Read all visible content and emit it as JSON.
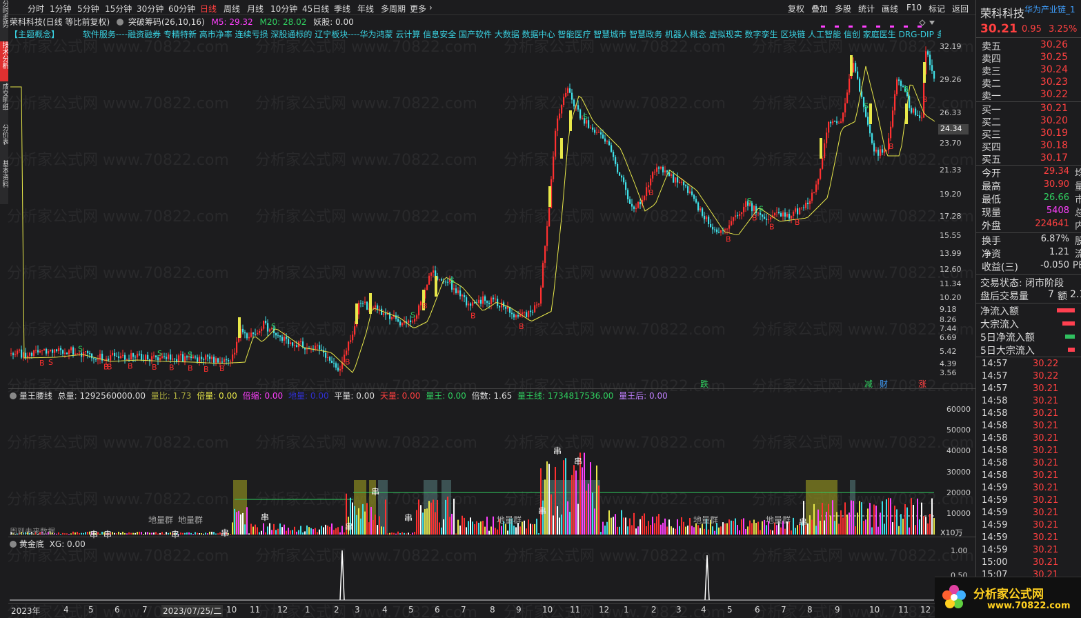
{
  "topbar": {
    "items": [
      "分时",
      "1分钟",
      "5分钟",
      "15分钟",
      "30分钟",
      "60分钟",
      "日线",
      "周线",
      "月线",
      "10分钟",
      "45日线",
      "季线",
      "年线",
      "多周期",
      "更多"
    ],
    "active": "日线",
    "right": [
      "复权",
      "叠加",
      "多股",
      "统计",
      "画线",
      "F10",
      "标记",
      "返回"
    ]
  },
  "lefttabs": [
    "分时走势",
    "技术分析",
    "成交明细",
    "分价表",
    "基本资料"
  ],
  "title": {
    "stock": "荣科科技(日线 等比前复权)",
    "indicator": "突破筹码(26,10,16)",
    "m5": "M5: 29.32",
    "m20": "M20: 28.02",
    "yao": "妖股: 0.00"
  },
  "concepts": {
    "label": "【主题概念】",
    "text": "软件服务----融资融券 专精特新 高市净率 连续亏损 深股通标的 辽宁板块----华为鸿蒙 云计算 信息安全 国产软件 大数据 数据中心 智能医疗 智慧城市 智慧政务 机器人概念 虚拟现实 数字孪生 区块链 人工智能 信创 家庭医生 DRG-DIP 多"
  },
  "price_axis": [
    "32.19",
    "29.26",
    "26.33",
    "23.70",
    "21.33",
    "19.20",
    "17.28",
    "15.55",
    "13.99",
    "12.60",
    "11.34",
    "10.20",
    "9.18",
    "8.26",
    "7.44",
    "6.69",
    "5.42",
    "4.39",
    "3.56"
  ],
  "current_price_tag": "24.34",
  "chart_markers": {
    "die": "跌",
    "jian": "减",
    "cai": "财",
    "zhang": "涨"
  },
  "ind1": {
    "name": "量王腰线",
    "zongliang": "总量: 1292560000.00",
    "liangbi": "量比: 1.73",
    "beiliang": "倍量: 0.00",
    "beisuo": "倍缩: 0.00",
    "hidden": "地量: 0.00",
    "pingliang": "平量: 0.00",
    "tianliang": "天量: 0.00",
    "liangwang": "量王: 0.00",
    "beishu": "倍数: 1.65",
    "liangwangxian": "量王线: 1734817536.00",
    "liangwanghou": "量王后: 0.00"
  },
  "vol_axis": [
    "60000",
    "50000",
    "40000",
    "30000",
    "20000",
    "10000"
  ],
  "vol_unit": "X10万",
  "vol_labels": [
    "地量群",
    "地量群",
    "地量群",
    "地量群",
    "地量群"
  ],
  "vol_marks": [
    "串",
    "串",
    "串",
    "串",
    "串",
    "串",
    "串",
    "串",
    "串"
  ],
  "vol_bottom_text": "周到未来数据",
  "ind2": {
    "name": "黄金底",
    "xg": "XG: 0.00"
  },
  "ind2_axis": [
    "1.00",
    "0.50"
  ],
  "xaxis": {
    "year": "2023年",
    "date": "2023/07/25/二",
    "months": [
      "4",
      "5",
      "6",
      "7",
      "10",
      "11",
      "12",
      "1",
      "2",
      "3",
      "4",
      "5",
      "6",
      "7",
      "8",
      "9",
      "10",
      "11",
      "12",
      "1",
      "2",
      "3",
      "4",
      "5",
      "6",
      "7",
      "8",
      "9",
      "10",
      "11",
      "12"
    ]
  },
  "quote": {
    "name": "荣科科技",
    "tag": "华为产业链_1",
    "price": "30.21",
    "change": "0.95",
    "pct": "3.25%"
  },
  "asks": [
    {
      "k": "卖五",
      "v": "30.26"
    },
    {
      "k": "卖四",
      "v": "30.25"
    },
    {
      "k": "卖三",
      "v": "30.24"
    },
    {
      "k": "卖二",
      "v": "30.23"
    },
    {
      "k": "卖一",
      "v": "30.22"
    }
  ],
  "bids": [
    {
      "k": "买一",
      "v": "30.21"
    },
    {
      "k": "买二",
      "v": "30.20"
    },
    {
      "k": "买三",
      "v": "30.19"
    },
    {
      "k": "买四",
      "v": "30.18"
    },
    {
      "k": "买五",
      "v": "30.17"
    }
  ],
  "stats": [
    {
      "k": "今开",
      "v": "29.34",
      "e": "均"
    },
    {
      "k": "最高",
      "v": "30.90",
      "e": "量"
    },
    {
      "k": "最低",
      "v": "26.66",
      "e": "市"
    },
    {
      "k": "现量",
      "v": "5408",
      "e": "总"
    },
    {
      "k": "外盘",
      "v": "224641",
      "e": "内"
    }
  ],
  "stats2": [
    {
      "k": "换手",
      "v": "6.87%",
      "e": "股"
    },
    {
      "k": "净资",
      "v": "1.21",
      "e": "流"
    },
    {
      "k": "收益(三)",
      "v": "-0.050",
      "e": "PE"
    }
  ],
  "trade": {
    "state": "交易状态: 闭市阶段",
    "after": "盘后交易量",
    "after_v": "7",
    "after_e": "额",
    "after_e2": "2.1"
  },
  "flows": [
    "净流入额",
    "大宗流入",
    "5日净流入额",
    "5日大宗流入"
  ],
  "ticks": [
    {
      "t": "14:57",
      "p": "30.22"
    },
    {
      "t": "14:57",
      "p": "30.22"
    },
    {
      "t": "14:57",
      "p": "30.21"
    },
    {
      "t": "14:58",
      "p": "30.21"
    },
    {
      "t": "14:58",
      "p": "30.21"
    },
    {
      "t": "14:58",
      "p": "30.21"
    },
    {
      "t": "14:58",
      "p": "30.21"
    },
    {
      "t": "14:58",
      "p": "30.21"
    },
    {
      "t": "14:58",
      "p": "30.21"
    },
    {
      "t": "14:58",
      "p": "30.21"
    },
    {
      "t": "14:59",
      "p": "30.21"
    },
    {
      "t": "14:59",
      "p": "30.21"
    },
    {
      "t": "14:59",
      "p": "30.21"
    },
    {
      "t": "14:59",
      "p": "30.21"
    },
    {
      "t": "14:59",
      "p": "30.21"
    },
    {
      "t": "14:59",
      "p": "30.21"
    },
    {
      "t": "15:00",
      "p": "30.21"
    },
    {
      "t": "15:07",
      "p": "30.21"
    }
  ],
  "watermark": "分析家公式网 www.70822.com",
  "logo": {
    "text": "分析家公式网",
    "url": "www.70822.com"
  },
  "colors": {
    "up": "#ff3030",
    "down": "#40e0e8",
    "ma": "#e8e84a",
    "bg": "#1c1c1e"
  }
}
